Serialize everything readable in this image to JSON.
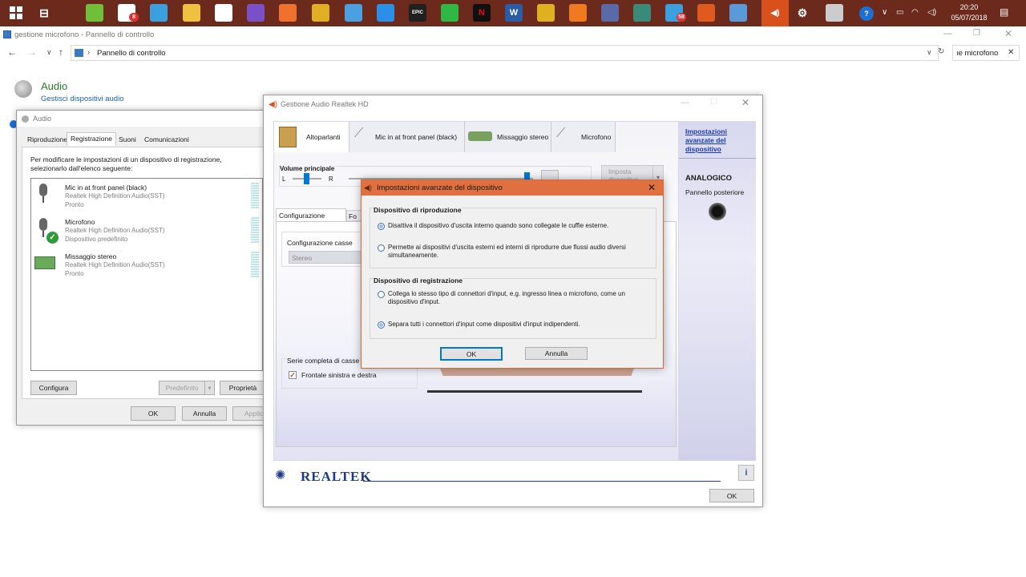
{
  "taskbar": {
    "time": "20:20",
    "date": "05/07/2018",
    "apps": [
      {
        "name": "start-icon",
        "color": "#ffffff"
      },
      {
        "name": "task-view-icon",
        "color": "#ffffff"
      },
      {
        "name": "evernote-icon",
        "color": "#6fbf3a"
      },
      {
        "name": "mail-icon",
        "color": "#ffffff",
        "badge": "8"
      },
      {
        "name": "notes-icon",
        "color": "#3aa0e0"
      },
      {
        "name": "folder-icon",
        "color": "#f0c040"
      },
      {
        "name": "dropbox-icon",
        "color": "#ffffff"
      },
      {
        "name": "visual-studio-icon",
        "color": "#7a4fc7"
      },
      {
        "name": "photo-icon",
        "color": "#f07030"
      },
      {
        "name": "chrome-icon",
        "color": "#e0b020"
      },
      {
        "name": "remote-desktop-icon",
        "color": "#4aa0e0"
      },
      {
        "name": "edge-icon",
        "color": "#2b8ee8"
      },
      {
        "name": "epic-games-icon",
        "color": "#202020",
        "label": "EPIC"
      },
      {
        "name": "whatsapp-icon",
        "color": "#2fb944"
      },
      {
        "name": "netflix-icon",
        "color": "#101010",
        "label": "N"
      },
      {
        "name": "word-icon",
        "color": "#2b5ca8",
        "label": "W"
      },
      {
        "name": "chrome-2-icon",
        "color": "#e0b020"
      },
      {
        "name": "avast-icon",
        "color": "#f07a20"
      },
      {
        "name": "monitor-icon",
        "color": "#5a6aa8"
      },
      {
        "name": "app-icon",
        "color": "#3a8a7a"
      },
      {
        "name": "telegram-icon",
        "color": "#3aa0e0",
        "badge": "58"
      },
      {
        "name": "browser-icon",
        "color": "#e05a20"
      },
      {
        "name": "display-icon",
        "color": "#5a9ad8"
      },
      {
        "name": "speaker-icon",
        "color": "#d8501c"
      },
      {
        "name": "settings-icon",
        "color": "#ffffff"
      },
      {
        "name": "mouse-icon",
        "color": "#cccccc"
      }
    ]
  },
  "explorer": {
    "title": "gestione microfono - Pannello di controllo",
    "breadcrumb": "Pannello di controllo",
    "search_value": "ıe microfono",
    "heading": "Audio",
    "link": "Gestisci dispositivi audio"
  },
  "audio_dialog": {
    "title": "Audio",
    "tabs": [
      "Riproduzione",
      "Registrazione",
      "Suoni",
      "Comunicazioni"
    ],
    "instructions": "Per modificare le impostazioni di un dispositivo di registrazione, selezionarlo dall'elenco seguente:",
    "devices": [
      {
        "name": "Mic in at front panel (black)",
        "driver": "Realtek High Definition Audio(SST)",
        "status": "Pronto"
      },
      {
        "name": "Microfono",
        "driver": "Realtek High Definition Audio(SST)",
        "status": "Dispositivo predefinito"
      },
      {
        "name": "Missaggio stereo",
        "driver": "Realtek High Definition Audio(SST)",
        "status": "Pronto"
      }
    ],
    "configure_label": "Configura",
    "default_label": "Predefinito",
    "properties_label": "Proprietà",
    "ok_label": "OK",
    "cancel_label": "Annulla",
    "apply_label": "Applica"
  },
  "realtek": {
    "title": "Gestione Audio Realtek HD",
    "tabs": [
      "Altoparlanti",
      "Mic in at front panel (black)",
      "Missaggio stereo",
      "Microfono"
    ],
    "volume_label": "Volume principale",
    "left_label": "L",
    "right_label": "R",
    "set_device_label": "Imposta dispositivo",
    "subtabs": [
      "Configurazione casse",
      "Fo"
    ],
    "config_label": "Configurazione casse",
    "config_value": "Stereo",
    "fullrange_label": "Serie completa di casse",
    "front_lr_label": "Frontale sinistra e destra",
    "side_link": "Impostazioni avanzate del dispositivo",
    "analog_label": "ANALOGICO",
    "back_panel_label": "Pannello posteriore",
    "brand": "REALTEK",
    "ok_label": "OK",
    "accent": "#d8501c"
  },
  "advanced_dialog": {
    "title": "Impostazioni avanzate del dispositivo",
    "playback_group": "Dispositivo di riproduzione",
    "playback_options": [
      "Disattiva il dispositivo d'uscita interno quando sono collegate le cuffie esterne.",
      "Permette ai dispositivi d'uscita esterni ed interni di riprodurre due flussi audio diversi simultaneamente."
    ],
    "recording_group": "Dispositivo di registrazione",
    "recording_options": [
      "Collega lo stesso tipo di connettori d'input, e.g. ingresso linea o microfono, come un dispositivo d'input.",
      "Separa tutti i connettori d'input come dispositivi d'input indipendenti."
    ],
    "ok_label": "OK",
    "cancel_label": "Annulla",
    "accent": "#e07040"
  }
}
